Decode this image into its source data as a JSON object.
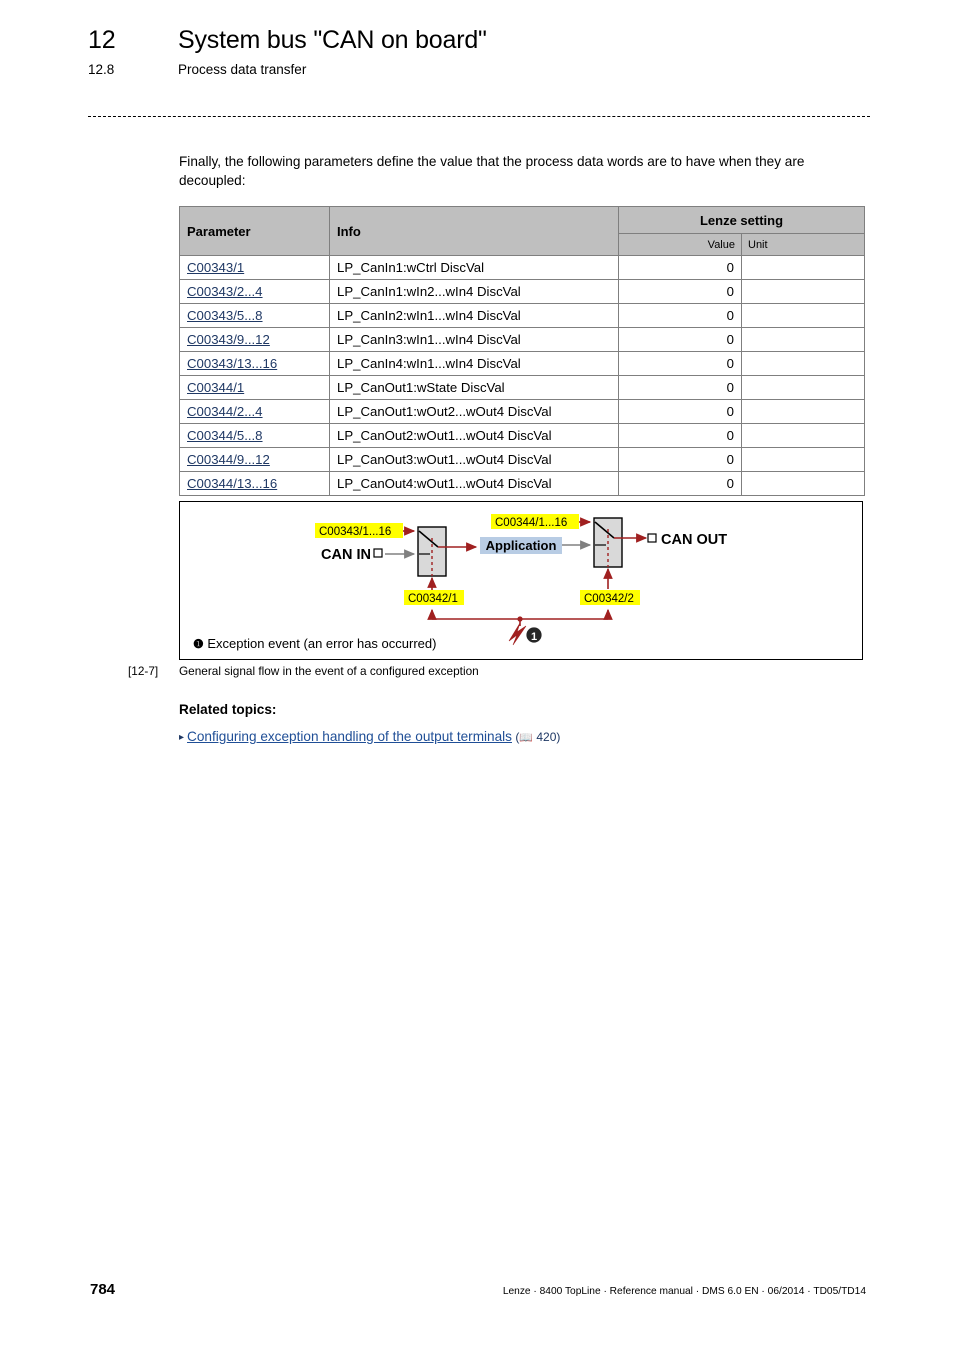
{
  "header": {
    "chapter_number": "12",
    "chapter_title": "System bus \"CAN on board\"",
    "section_number": "12.8",
    "section_title": "Process data transfer"
  },
  "intro_paragraph": "Finally, the following parameters define the value that the process data words are to have when they are decoupled:",
  "table": {
    "columns": {
      "parameter": "Parameter",
      "info": "Info",
      "lenze_setting": "Lenze setting",
      "value": "Value",
      "unit": "Unit"
    },
    "rows": [
      {
        "parameter": "C00343/1",
        "info": "LP_CanIn1:wCtrl DiscVal",
        "value": "0",
        "unit": ""
      },
      {
        "parameter": "C00343/2...4",
        "info": "LP_CanIn1:wIn2...wIn4 DiscVal",
        "value": "0",
        "unit": ""
      },
      {
        "parameter": "C00343/5...8",
        "info": "LP_CanIn2:wIn1...wIn4 DiscVal",
        "value": "0",
        "unit": ""
      },
      {
        "parameter": "C00343/9...12",
        "info": "LP_CanIn3:wIn1...wIn4 DiscVal",
        "value": "0",
        "unit": ""
      },
      {
        "parameter": "C00343/13...16",
        "info": "LP_CanIn4:wIn1...wIn4 DiscVal",
        "value": "0",
        "unit": ""
      },
      {
        "parameter": "C00344/1",
        "info": "LP_CanOut1:wState DiscVal",
        "value": "0",
        "unit": ""
      },
      {
        "parameter": "C00344/2...4",
        "info": "LP_CanOut1:wOut2...wOut4 DiscVal",
        "value": "0",
        "unit": ""
      },
      {
        "parameter": "C00344/5...8",
        "info": "LP_CanOut2:wOut1...wOut4 DiscVal",
        "value": "0",
        "unit": ""
      },
      {
        "parameter": "C00344/9...12",
        "info": "LP_CanOut3:wOut1...wOut4 DiscVal",
        "value": "0",
        "unit": ""
      },
      {
        "parameter": "C00344/13...16",
        "info": "LP_CanOut4:wOut1...wOut4 DiscVal",
        "value": "0",
        "unit": ""
      }
    ]
  },
  "figure": {
    "labels": {
      "can_in": "CAN IN",
      "can_out": "CAN OUT",
      "application": "Application",
      "param_in": "C00343/1...16",
      "param_out": "C00344/1...16",
      "param_sw_left": "C00342/1",
      "param_sw_right": "C00342/2"
    },
    "legend_marker": "❶",
    "legend_text": "Exception event (an error has occurred)",
    "caption_number": "[12-7]",
    "caption_text": "General signal flow in the event of a configured exception",
    "colors": {
      "highlight": "#ffff00",
      "signal_red": "#a02020",
      "application_fill": "#b8cce4",
      "switch_fill": "#d9d9d9",
      "gray_signal": "#808080"
    }
  },
  "related": {
    "heading": "Related topics:",
    "bullet": "▸",
    "link_text": "Configuring exception handling of the output terminals",
    "book_icon": "📖",
    "page_ref": "420"
  },
  "footer": {
    "page_number": "784",
    "info": "Lenze · 8400 TopLine · Reference manual · DMS 6.0 EN · 06/2014 · TD05/TD14"
  }
}
